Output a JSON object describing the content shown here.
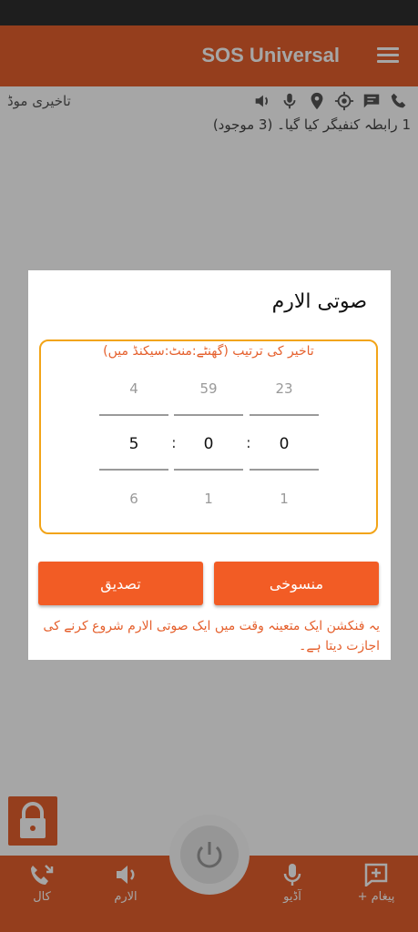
{
  "app": {
    "title": "SOS Universal"
  },
  "info": {
    "delay_mode": "تاخیری موڈ",
    "contacts_status": "1 رابطہ کنفیگر کیا گیا۔ (3 موجود)"
  },
  "nav": {
    "message_label": "+ پیغام",
    "audio_label": "آڈیو",
    "alarm_label": "الارم",
    "call_label": "کال"
  },
  "dialog": {
    "title": "صوتی الارم",
    "picker_label": "تاخیر کی ترتیب (گھنٹے:منٹ:سیکنڈ میں)",
    "hours": {
      "prev": "23",
      "current": "0",
      "next": "1"
    },
    "minutes": {
      "prev": "59",
      "current": "0",
      "next": "1"
    },
    "seconds": {
      "prev": "4",
      "current": "5",
      "next": "6"
    },
    "separator": ":",
    "cancel_label": "منسوخی",
    "confirm_label": "تصدیق",
    "description": "یہ فنکشن ایک متعینہ وقت میں ایک صوتی الارم شروع کرنے کی اجازت دیتا ہے۔"
  },
  "colors": {
    "accent": "#e5602d",
    "button": "#f25c25",
    "picker_border": "#f2a418"
  }
}
